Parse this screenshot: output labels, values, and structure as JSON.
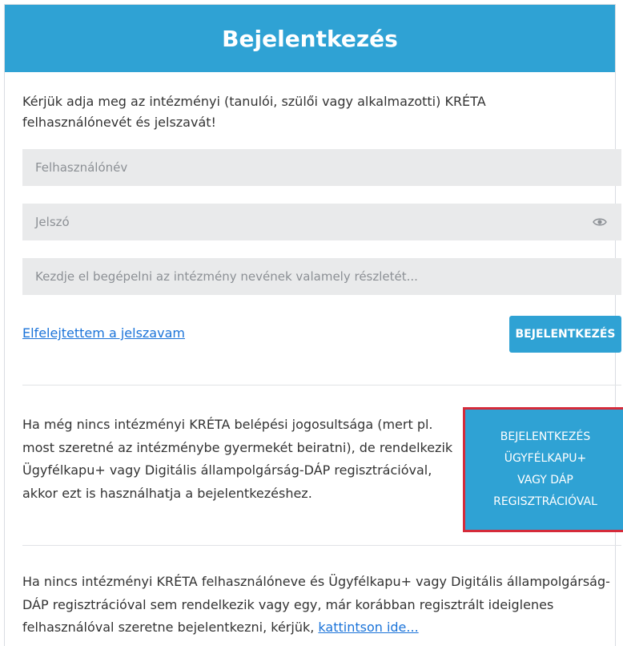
{
  "header": {
    "title": "Bejelentkezés"
  },
  "intro": {
    "text": "Kérjük adja meg az intézményi (tanulói, szülői vagy alkalmazotti) KRÉTA felhasználónevét és jelszavát!"
  },
  "form": {
    "username_placeholder": "Felhasználónév",
    "password_placeholder": "Jelszó",
    "institution_placeholder": "Kezdje el begépelni az intézmény nevének valamely részletét...",
    "password_toggle_icon": "eye-icon"
  },
  "actions": {
    "forgot_password": "Elfelejtettem a jelszavam",
    "login_button": "BEJELENTKEZÉS"
  },
  "sso": {
    "text": "Ha még nincs intézményi KRÉTA belépési jogosultsága (mert pl. most szeretné az intézménybe gyermekét beiratni), de rendelkezik Ügyfélkapu+ vagy Digitális állampolgárság-DÁP regisztrációval, akkor ezt is használhatja a bejelentkezéshez.",
    "button_lines": [
      "BEJELENTKEZÉS",
      "ÜGYFÉLKAPU+",
      "VAGY DÁP",
      "REGISZTRÁCIÓVAL"
    ]
  },
  "bottom": {
    "text": "Ha nincs intézményi KRÉTA felhasználóneve és Ügyfélkapu+ vagy Digitális állampolgárság-DÁP regisztrációval sem rendelkezik vagy egy, már korábban regisztrált ideiglenes felhasználóval szeretne bejelentkezni, kérjük, ",
    "link": "kattintson ide..."
  },
  "colors": {
    "primary": "#2fa2d4",
    "highlight_border": "#d52b3a",
    "link": "#1a73d9",
    "field_bg": "#e9eaeb"
  }
}
